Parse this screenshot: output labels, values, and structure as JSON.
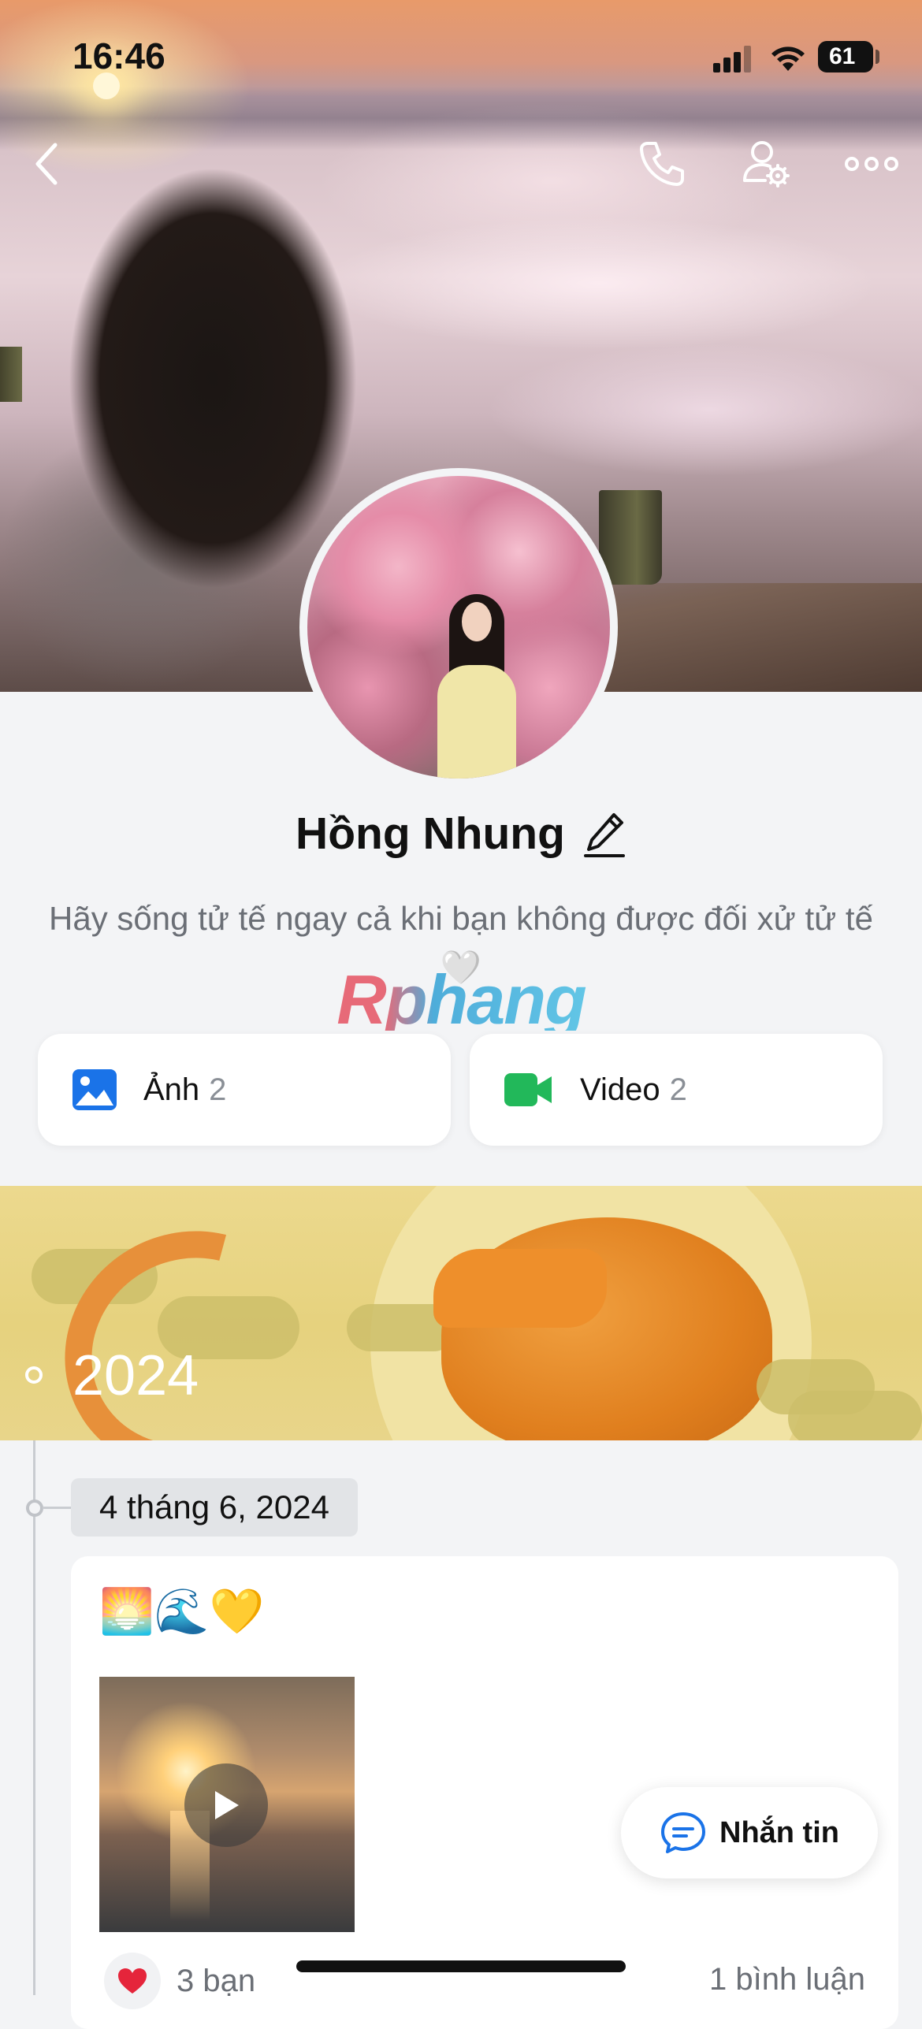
{
  "status_bar": {
    "time": "16:46",
    "battery": "61"
  },
  "profile": {
    "name": "Hồng Nhung",
    "bio": "Hãy sống tử tế ngay cả khi bạn không được đối xử tử tế 🤍"
  },
  "watermark": "Rphang",
  "media": {
    "photos": {
      "label": "Ảnh",
      "count": "2"
    },
    "videos": {
      "label": "Video",
      "count": "2"
    }
  },
  "timeline": {
    "year": "2024",
    "date": "4 tháng 6, 2024",
    "post": {
      "emojis": "🌅🌊💛",
      "reaction_emoji": "❤️",
      "reaction_count": "3 bạn",
      "comment_count": "1 bình luận"
    }
  },
  "message_button": {
    "label": "Nhắn tin"
  },
  "colors": {
    "accent_blue": "#1a73e8",
    "video_green": "#22b85a",
    "background": "#f3f4f6"
  },
  "icons": [
    "back-icon",
    "phone-icon",
    "profile-settings-icon",
    "more-icon",
    "image-icon",
    "video-camera-icon",
    "play-icon",
    "heart-icon",
    "chat-bubble-icon",
    "pencil-icon"
  ]
}
